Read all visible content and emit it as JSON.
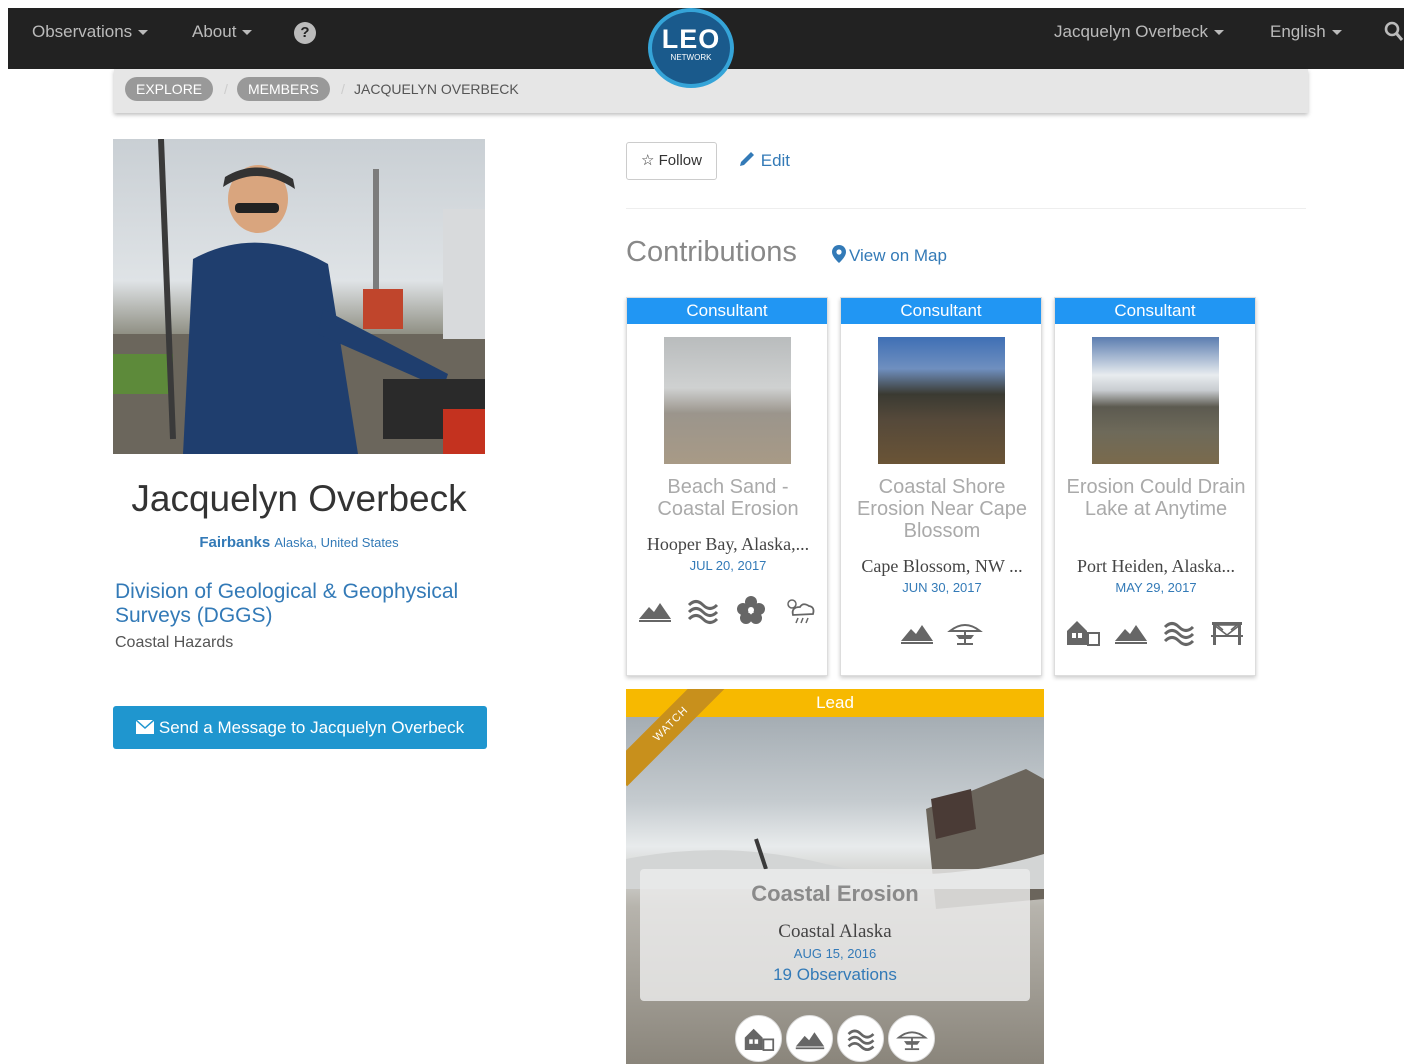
{
  "navbar": {
    "observations_label": "Observations",
    "about_label": "About",
    "help_label": "?",
    "logo_text": "LEO",
    "logo_subtext": "NETWORK",
    "user_label": "Jacquelyn Overbeck",
    "language_label": "English"
  },
  "breadcrumb": {
    "explore": "EXPLORE",
    "members": "MEMBERS",
    "current": "JACQUELYN OVERBECK"
  },
  "profile": {
    "name": "Jacquelyn Overbeck",
    "city": "Fairbanks",
    "region": "Alaska, United States",
    "org": "Division of Geological & Geophysical Surveys (DGGS)",
    "department": "Coastal Hazards",
    "message_button": "Send a Message to Jacquelyn Overbeck"
  },
  "actions": {
    "follow_label": "Follow",
    "edit_label": "Edit"
  },
  "contributions": {
    "title": "Contributions",
    "map_link": "View on Map",
    "cards": [
      {
        "badge": "Consultant",
        "title": "Beach Sand - Coastal Erosion",
        "location": "Hooper Bay, Alaska,...",
        "date": "JUL 20, 2017",
        "icons": [
          "land-icon",
          "water-icon",
          "flower-icon",
          "weather-icon"
        ]
      },
      {
        "badge": "Consultant",
        "title": "Coastal Shore Erosion Near Cape Blossom",
        "location": "Cape Blossom, NW ...",
        "date": "JUN 30, 2017",
        "icons": [
          "land-icon",
          "sea-ice-icon"
        ]
      },
      {
        "badge": "Consultant",
        "title": "Erosion Could Drain Lake at Anytime",
        "location": "Port Heiden, Alaska...",
        "date": "MAY 29, 2017",
        "icons": [
          "building-icon",
          "land-icon",
          "water-icon",
          "infrastructure-icon"
        ]
      }
    ],
    "featured": {
      "badge": "Lead",
      "ribbon": "WATCH",
      "title": "Coastal Erosion",
      "location": "Coastal Alaska",
      "date": "AUG 15, 2016",
      "observations": "19 Observations",
      "icons": [
        "building-icon",
        "land-icon",
        "water-icon",
        "sea-ice-icon"
      ]
    }
  },
  "colors": {
    "navbar": "#222222",
    "link": "#337ab7",
    "consultant_header": "#2196f3",
    "lead_header": "#f7b900",
    "message_button": "#1f96cf"
  }
}
